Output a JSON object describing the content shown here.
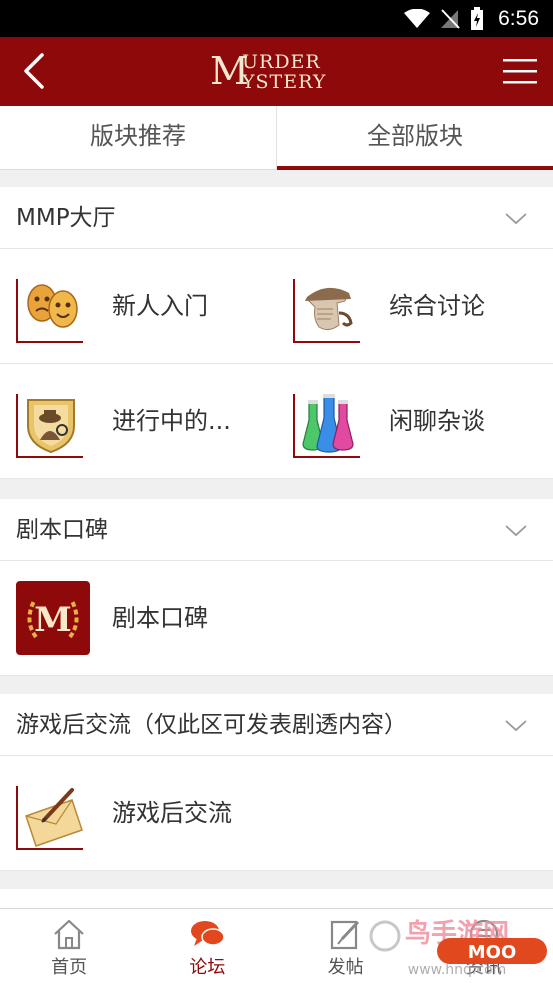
{
  "status": {
    "time": "6:56"
  },
  "header": {
    "logo_top": "URDER",
    "logo_bottom": "YSTERY",
    "logo_initial": "M"
  },
  "tabs": [
    {
      "label": "版块推荐",
      "active": false
    },
    {
      "label": "全部版块",
      "active": true
    }
  ],
  "sections": [
    {
      "title": "MMP大厅",
      "forums": [
        {
          "label": "新人入门",
          "icon": "theater-masks-icon"
        },
        {
          "label": "综合讨论",
          "icon": "detective-profile-icon"
        },
        {
          "label": "进行中的...",
          "icon": "detective-badge-icon"
        },
        {
          "label": "闲聊杂谈",
          "icon": "chemistry-flasks-icon"
        }
      ]
    },
    {
      "title": "剧本口碑",
      "forums": [
        {
          "label": "剧本口碑",
          "icon": "murder-mystery-laurel-icon"
        }
      ]
    },
    {
      "title": "游戏后交流（仅此区可发表剧透内容）",
      "forums": [
        {
          "label": "游戏后交流",
          "icon": "envelope-pen-icon"
        }
      ]
    }
  ],
  "bottom_nav": [
    {
      "label": "首页",
      "icon": "home-icon",
      "active": false
    },
    {
      "label": "论坛",
      "icon": "chat-bubbles-icon",
      "active": true
    },
    {
      "label": "发帖",
      "icon": "edit-post-icon",
      "active": false
    },
    {
      "label": "资讯",
      "icon": "news-icon",
      "active": false
    }
  ],
  "watermark": {
    "text": "www.hnq.com",
    "badge": "MOO"
  },
  "colors": {
    "brand": "#8e0a0a",
    "background": "#f0f0f0"
  }
}
